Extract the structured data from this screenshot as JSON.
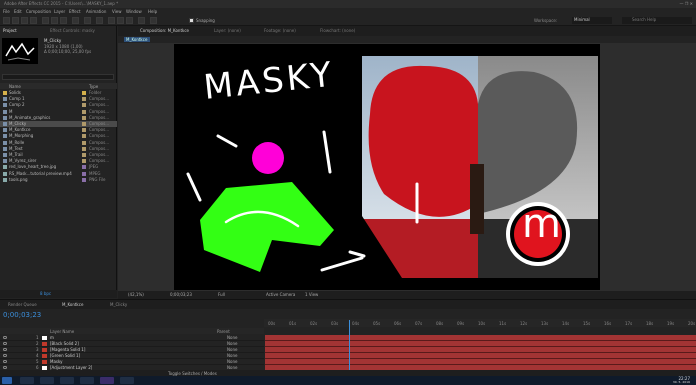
{
  "window": {
    "title": "Adobe After Effects CC 2015 - C:\\Users\\...\\MASKY_1.aep *"
  },
  "menu": [
    "File",
    "Edit",
    "Composition",
    "Layer",
    "Effect",
    "Animation",
    "View",
    "Window",
    "Help"
  ],
  "toolbar": {
    "snapping_label": "Snapping",
    "workspace_label": "Workspace:",
    "workspace_value": "Minimal",
    "search_placeholder": "Search Help"
  },
  "project": {
    "tab_project": "Project",
    "tab_effects": "Effect Controls: masky",
    "selected_name": "M_Clicky",
    "info_lines": [
      "1920 x 1080 (1,00)",
      "Δ 0;00;10;00, 25,00 fps"
    ],
    "col_name": "Name",
    "col_type": "Type",
    "items": [
      {
        "name": "Solids",
        "type": "Folder",
        "icon": "#d4b04a",
        "label": "#d4b04a"
      },
      {
        "name": "Comp 1",
        "type": "Compos...",
        "icon": "#7a8fa8",
        "label": "#b09a6a"
      },
      {
        "name": "Comp 2",
        "type": "Compos...",
        "icon": "#7a8fa8",
        "label": "#b09a6a"
      },
      {
        "name": "M",
        "type": "Compos...",
        "icon": "#7a8fa8",
        "label": "#b09a6a"
      },
      {
        "name": "M_Animate_graphics",
        "type": "Compos...",
        "icon": "#7a8fa8",
        "label": "#b09a6a"
      },
      {
        "name": "M_Clicky",
        "type": "Compos...",
        "icon": "#7a8fa8",
        "label": "#b09a6a",
        "selected": true
      },
      {
        "name": "M_Kontkce",
        "type": "Compos...",
        "icon": "#7a8fa8",
        "label": "#b09a6a"
      },
      {
        "name": "M_Morphing",
        "type": "Compos...",
        "icon": "#7a8fa8",
        "label": "#b09a6a"
      },
      {
        "name": "M_Rolle",
        "type": "Compos...",
        "icon": "#7a8fa8",
        "label": "#b09a6a"
      },
      {
        "name": "M_Text",
        "type": "Compos...",
        "icon": "#7a8fa8",
        "label": "#b09a6a"
      },
      {
        "name": "M_Trail",
        "type": "Compos...",
        "icon": "#7a8fa8",
        "label": "#b09a6a"
      },
      {
        "name": "M_Vyrez_sirer",
        "type": "Compos...",
        "icon": "#7a8fa8",
        "label": "#b09a6a"
      },
      {
        "name": "red_love_heart_tree.jpg",
        "type": "JPEG",
        "icon": "#8aa",
        "label": "#8a6fa8"
      },
      {
        "name": "RS_Mask...tutorial preview.mp4",
        "type": "MPEG",
        "icon": "#8aa",
        "label": "#8a6fa8"
      },
      {
        "name": "tools.png",
        "type": "PNG File",
        "icon": "#8aa",
        "label": "#8a6fa8"
      }
    ],
    "bpc": "8 bpc"
  },
  "composition": {
    "tabs": [
      {
        "label": "Composition: M_Kontkce",
        "active": true
      },
      {
        "label": "Layer: (none)",
        "active": false
      },
      {
        "label": "Footage: (none)",
        "active": false
      },
      {
        "label": "Flowchart: (none)",
        "active": false
      }
    ],
    "breadcrumb": "M_Kontkce",
    "canvas_text": "MASKY",
    "logo_letter": "m",
    "viewer_bar": {
      "zoom": "(42,1%)",
      "timecode": "0;00;03;23",
      "resolution": "Full",
      "camera": "Active Camera",
      "views": "1 View"
    }
  },
  "timeline": {
    "tabs": [
      {
        "label": "Render Queue",
        "active": false
      },
      {
        "label": "M_Kontkce",
        "active": true
      },
      {
        "label": "M_Clicky",
        "active": false
      }
    ],
    "timecode": "0;00;03;23",
    "header": {
      "layer_name": "Layer Name",
      "parent": "Parent"
    },
    "ruler": [
      "00s",
      "01s",
      "02s",
      "03s",
      "04s",
      "05s",
      "06s",
      "07s",
      "08s",
      "09s",
      "10s",
      "11s",
      "12s",
      "13s",
      "14s",
      "15s",
      "16s",
      "17s",
      "18s",
      "19s",
      "20s"
    ],
    "layers": [
      {
        "num": "1",
        "name": "m",
        "mode": "None",
        "color": "#ffffff"
      },
      {
        "num": "2",
        "name": "[Black Solid 2]",
        "mode": "None",
        "color": "#c0392b"
      },
      {
        "num": "3",
        "name": "[Magenta Solid 1]",
        "mode": "None",
        "color": "#c0392b"
      },
      {
        "num": "4",
        "name": "[Green Solid 1]",
        "mode": "None",
        "color": "#c0392b"
      },
      {
        "num": "5",
        "name": "Masky",
        "mode": "None",
        "color": "#c0392b"
      },
      {
        "num": "6",
        "name": "[Adjustment Layer 2]",
        "mode": "None",
        "color": "#ffffff"
      }
    ],
    "footer": "Toggle Switches / Modes"
  },
  "taskbar": {
    "time": "22:27",
    "date": "30. 5. 2016"
  }
}
